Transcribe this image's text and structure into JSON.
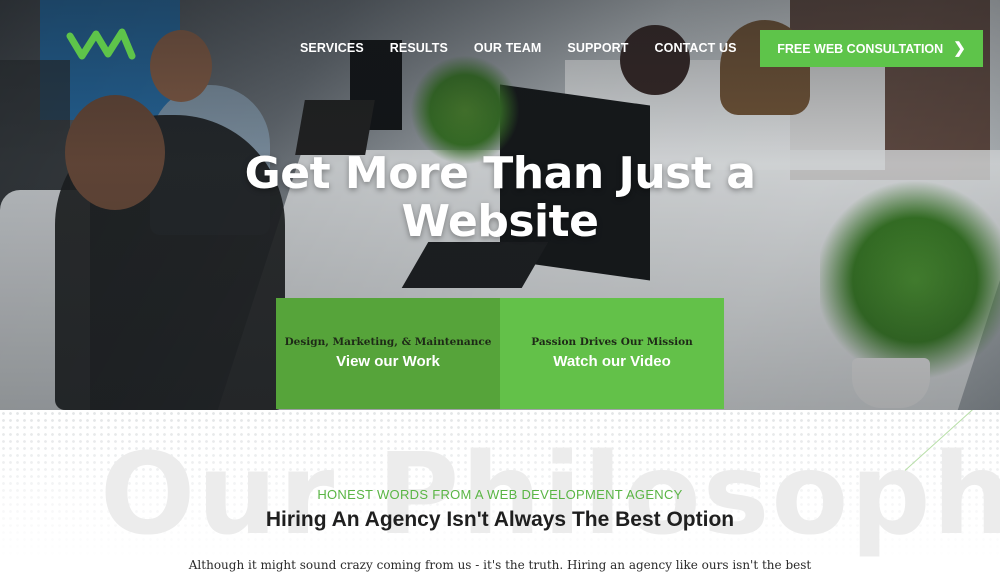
{
  "brand": {
    "logo_name": "wm-logo",
    "accent": "#5ec44a"
  },
  "nav": {
    "items": [
      {
        "label": "SERVICES"
      },
      {
        "label": "RESULTS"
      },
      {
        "label": "OUR TEAM"
      },
      {
        "label": "SUPPORT"
      },
      {
        "label": "CONTACT US"
      }
    ],
    "cta_label": "FREE WEB CONSULTATION",
    "cta_icon": "chevron-right-icon"
  },
  "hero": {
    "headline": "Get More Than Just a Website",
    "left_box": {
      "kicker": "Design, Marketing, & Maintenance",
      "link": "View our Work",
      "color": "#56a43a"
    },
    "right_box": {
      "kicker": "Passion Drives Our Mission",
      "link": "Watch our Video",
      "color": "#63c149"
    }
  },
  "philosophy": {
    "watermark": "Our Philosophy",
    "eyebrow": "HONEST WORDS FROM A WEB DEVELOPMENT AGENCY",
    "heading": "Hiring An Agency Isn't Always The Best Option",
    "paragraph": "Although it might sound crazy coming from us - it's the truth. Hiring an agency like ours isn't the best"
  }
}
